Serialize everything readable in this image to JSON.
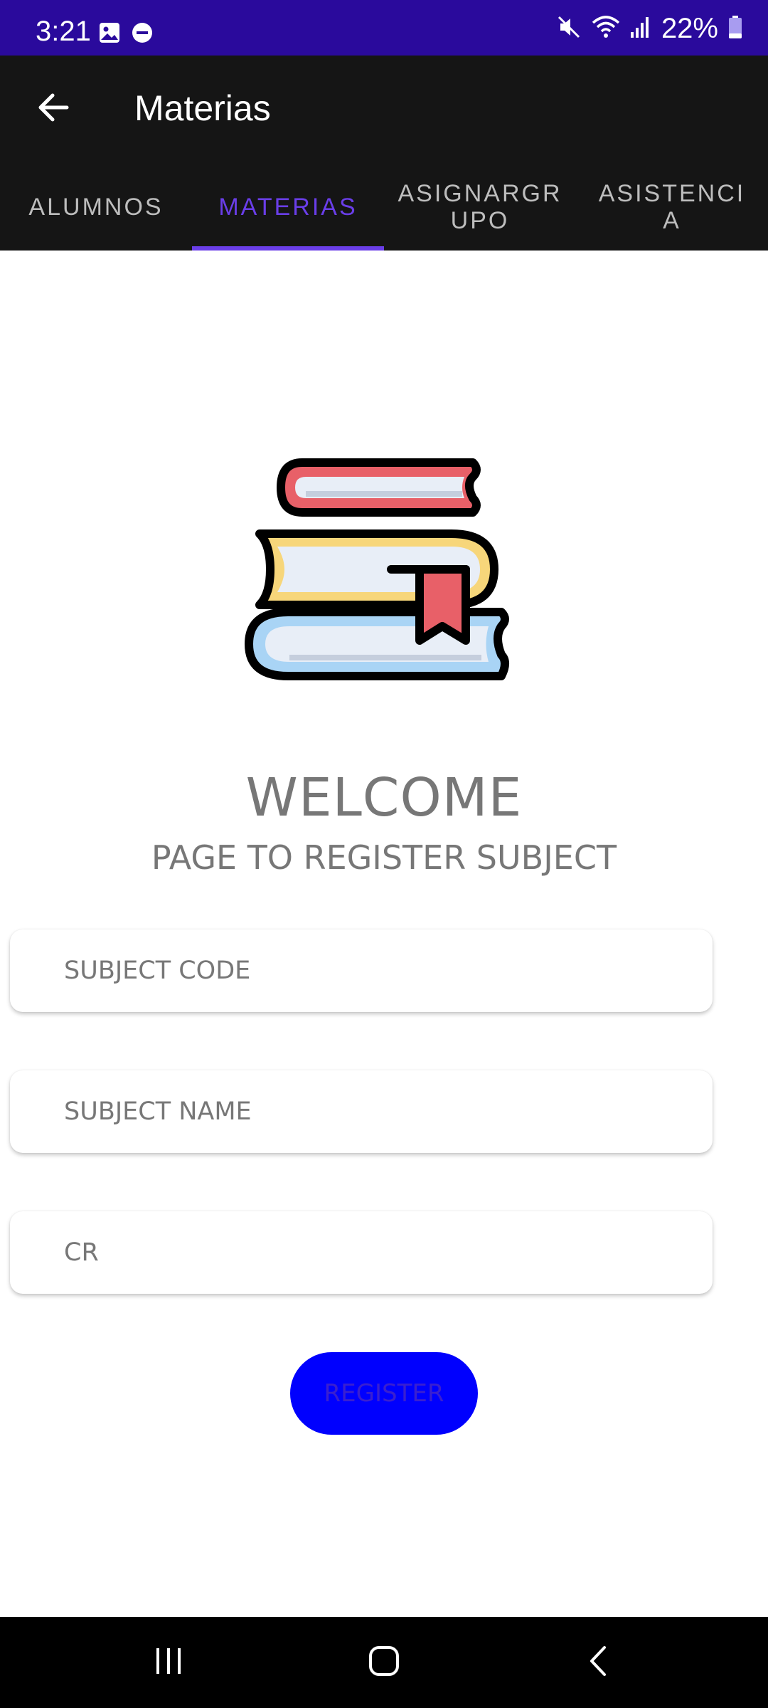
{
  "status_bar": {
    "time": "3:21",
    "battery": "22%",
    "left_icons": [
      "image-icon",
      "do-not-disturb-icon"
    ],
    "right_icons": [
      "mute-icon",
      "wifi-icon",
      "signal-icon",
      "battery-icon"
    ]
  },
  "app_bar": {
    "title": "Materias",
    "back_icon": "arrow-back-icon"
  },
  "tabs": [
    {
      "label": "ALUMNOS",
      "active": false
    },
    {
      "label": "MATERIAS",
      "active": true
    },
    {
      "label": "ASIGNARGR\nUPO",
      "active": false
    },
    {
      "label": "ASISTENCI\nA",
      "active": false
    }
  ],
  "main": {
    "illustration": "books-stack-icon",
    "welcome_title": "WELCOME",
    "welcome_subtitle": "PAGE TO REGISTER SUBJECT",
    "fields": {
      "subject_code": {
        "placeholder": "SUBJECT CODE",
        "value": ""
      },
      "subject_name": {
        "placeholder": "SUBJECT NAME",
        "value": ""
      },
      "credits": {
        "placeholder": "CR",
        "value": ""
      }
    },
    "register_label": "REGISTER"
  },
  "colors": {
    "status_bar": "#2a0a9c",
    "app_bar": "#151515",
    "accent": "#6a3ee8",
    "register_button": "#0000fe"
  },
  "nav_bar": {
    "buttons": [
      "recents-icon",
      "home-icon",
      "back-icon"
    ]
  }
}
